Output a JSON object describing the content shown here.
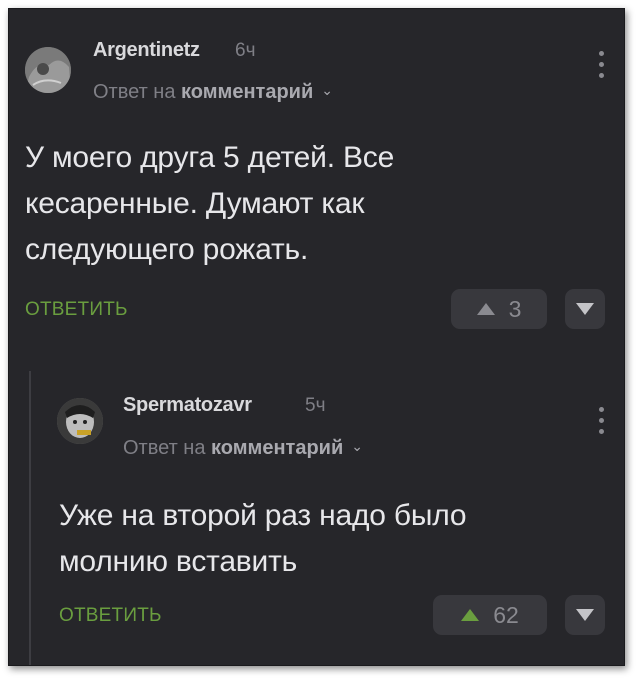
{
  "colors": {
    "background": "#26262a",
    "accent_green": "#6a9e3f",
    "text": "#e7e7ea",
    "muted": "#7f7f86"
  },
  "comments": [
    {
      "author": "Argentinetz",
      "time": "6ч",
      "reply_prefix": "Ответ на",
      "reply_link": "комментарий",
      "text": [
        "У моего друга 5 детей. Все",
        "кесаренные. Думают как",
        "следующего рожать."
      ],
      "reply_label": "ОТВЕТИТЬ",
      "votes": "3",
      "up_icon": "triangle-up-icon",
      "down_icon": "triangle-down-icon"
    },
    {
      "author": "Spermatozavr",
      "time": "5ч",
      "reply_prefix": "Ответ на",
      "reply_link": "комментарий",
      "text": [
        "Уже на второй раз надо было",
        "молнию вставить"
      ],
      "reply_label": "ОТВЕТИТЬ",
      "votes": "62",
      "up_icon": "triangle-up-icon",
      "down_icon": "triangle-down-icon"
    }
  ]
}
